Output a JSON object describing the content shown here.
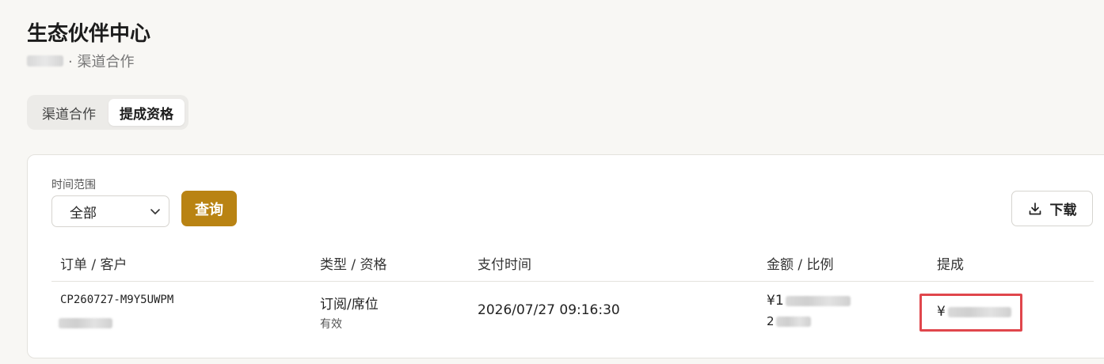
{
  "header": {
    "title": "生态伙伴中心",
    "breadcrumb_suffix": "· 渠道合作"
  },
  "tabs": [
    {
      "label": "渠道合作",
      "active": false
    },
    {
      "label": "提成资格",
      "active": true
    }
  ],
  "filter": {
    "label": "时间范围",
    "selected": "全部",
    "query_label": "查询",
    "download_label": "下载"
  },
  "table": {
    "columns": [
      "订单 / 客户",
      "类型 / 资格",
      "支付时间",
      "金额 / 比例",
      "提成"
    ],
    "rows": [
      {
        "order_id": "CP260727-M9Y5UWPM",
        "type": "订阅/席位",
        "qualification": "有效",
        "pay_time": "2026/07/27 09:16:30",
        "amount_prefix": "¥1",
        "ratio_prefix": "2",
        "commission_prefix": "¥"
      }
    ]
  },
  "colors": {
    "accent": "#b98313",
    "highlight": "#e0464c",
    "background": "#f8f7f4"
  },
  "icons": {
    "select_chevron": "chevron-down-icon",
    "download": "download-icon"
  }
}
